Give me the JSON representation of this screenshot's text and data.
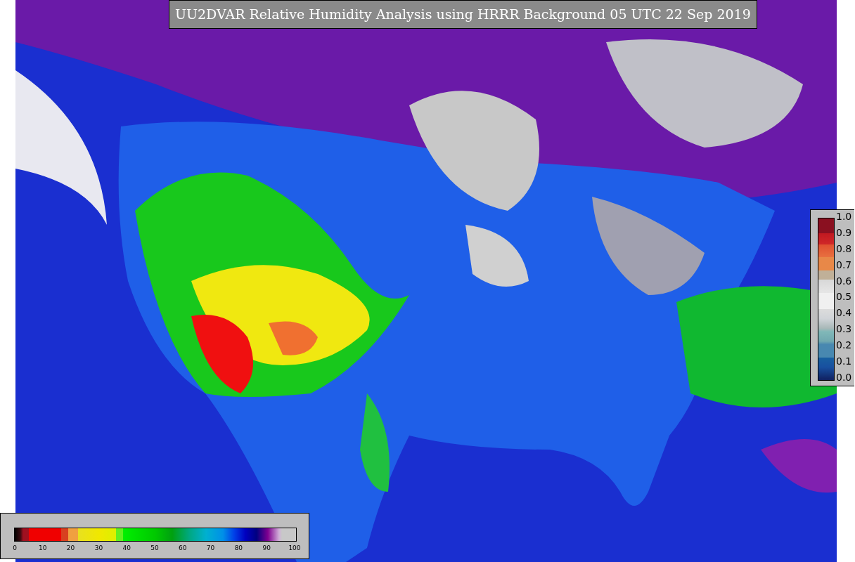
{
  "title": "UU2DVAR Relative Humidity Analysis using HRRR Background 05 UTC 22 Sep 2019",
  "humidity_colorbar": {
    "ticks": [
      "0",
      "10",
      "20",
      "30",
      "40",
      "50",
      "60",
      "70",
      "80",
      "90",
      "100"
    ]
  },
  "observation_colorbar": {
    "ticks": [
      "1.0",
      "0.9",
      "0.8",
      "0.7",
      "0.6",
      "0.5",
      "0.4",
      "0.3",
      "0.2",
      "0.1",
      "0.0"
    ]
  }
}
